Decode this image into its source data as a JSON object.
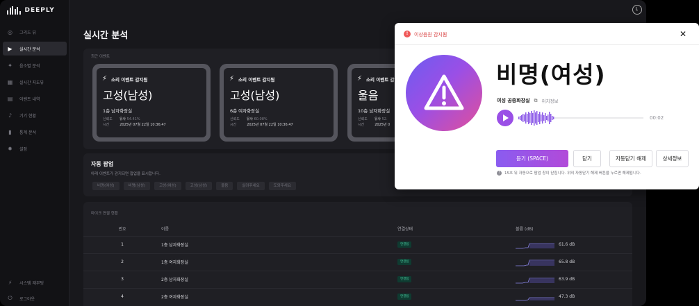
{
  "app": {
    "brand": "DEEPLY"
  },
  "sidebar": {
    "items": [
      {
        "label": "그리드 뷰",
        "icon": "grid-icon",
        "active": false
      },
      {
        "label": "실시간 분석",
        "icon": "play-icon",
        "active": true
      },
      {
        "label": "음소별 분석",
        "icon": "sparkle-icon",
        "active": false
      },
      {
        "label": "실시간 지도뷰",
        "icon": "map-icon",
        "active": false
      },
      {
        "label": "이벤트 내역",
        "icon": "list-icon",
        "active": false
      },
      {
        "label": "기기 현황",
        "icon": "mic-icon",
        "active": false
      },
      {
        "label": "통계 분석",
        "icon": "chart-icon",
        "active": false
      },
      {
        "label": "설정",
        "icon": "gear-icon",
        "active": false
      }
    ],
    "bottom": [
      {
        "label": "시스템 재부팅",
        "icon": "power-icon"
      },
      {
        "label": "로그아웃",
        "icon": "logout-icon"
      }
    ]
  },
  "page": {
    "title": "실시간 분석"
  },
  "recent": {
    "label": "최근 이벤트",
    "cards": [
      {
        "head": "소리 이벤트 감지됨",
        "title": "고성(남성)",
        "location": "1층 남자화장실",
        "confidence_label": "신뢰도",
        "confidence_value": "유사",
        "confidence_pct": "54.41%",
        "time_label": "시간",
        "time_value": "2025년 07월 22일 10:36:47"
      },
      {
        "head": "소리 이벤트 감지됨",
        "title": "고성(남성)",
        "location": "6층 여자화장실",
        "confidence_label": "신뢰도",
        "confidence_value": "유사",
        "confidence_pct": "60.08%",
        "time_label": "시간",
        "time_value": "2025년 07월 22일 10:36:47"
      },
      {
        "head": "소리 이벤트 감",
        "title": "울음",
        "location": "10층 남자화장실",
        "confidence_label": "신뢰도",
        "confidence_value": "유사",
        "confidence_pct": "52.",
        "time_label": "시간",
        "time_value": "2025년 0"
      }
    ]
  },
  "auto_popup": {
    "title": "자동 팝업",
    "desc": "아래 이벤트가 감지되면 팝업을 표시합니다.",
    "chips": [
      "비명(여성)",
      "비명(남성)",
      "고성(여성)",
      "고성(남성)",
      "울음",
      "살려주세요",
      "도와주세요"
    ]
  },
  "mic": {
    "label": "마이크 연결 현황",
    "headers": {
      "no": "번호",
      "name": "이름",
      "status": "연결상태",
      "volume": "볼륨 (dB)"
    },
    "rows": [
      {
        "no": "1",
        "name": "1층 남자화장실",
        "status": "연결됨",
        "db": "61.6 dB"
      },
      {
        "no": "2",
        "name": "1층 여자화장실",
        "status": "연결됨",
        "db": "65.8 dB"
      },
      {
        "no": "3",
        "name": "2층 남자화장실",
        "status": "연결됨",
        "db": "63.9 dB"
      },
      {
        "no": "4",
        "name": "2층 여자화장실",
        "status": "연결됨",
        "db": "47.3 dB"
      }
    ]
  },
  "modal": {
    "alert_num": "!",
    "alert_title": "이상음원 감지됨",
    "close": "✕",
    "title": "비명(여성)",
    "location": "여성 공중화장실",
    "location_link": "위치정보",
    "time": "00:02",
    "buttons": {
      "listen": "듣기 (SPACE)",
      "close": "닫기",
      "auto_close_off": "자동닫기 해제",
      "detail": "상세정보"
    },
    "note": "15초 뒤 자동으로 팝업 창이 닫힙니다. 위의 자동닫기 해제 버튼을 누르면 해제됩니다.",
    "colors": {
      "accent": "#9a4fe6",
      "alert": "#d84040"
    }
  }
}
